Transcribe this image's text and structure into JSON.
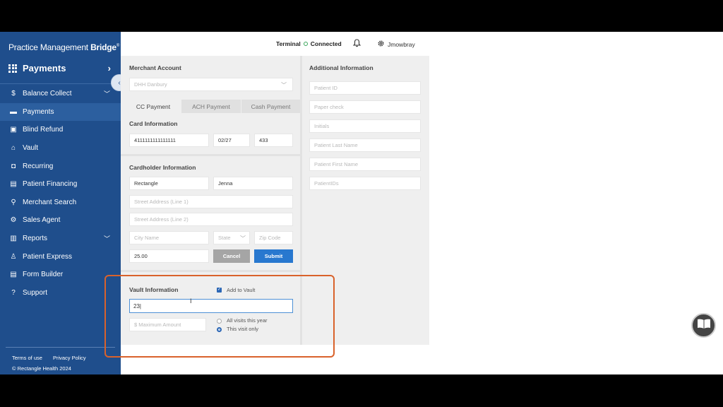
{
  "brand": {
    "name_prefix": "Practice Management ",
    "name_bold": "Bridge",
    "mark": "®"
  },
  "section": {
    "title": "Payments",
    "chevron": "›"
  },
  "nav": [
    {
      "label": "Balance Collect",
      "icon": "$",
      "has_chevron": true
    },
    {
      "label": "Payments",
      "icon": "▬",
      "active": true
    },
    {
      "label": "Blind Refund",
      "icon": "▣"
    },
    {
      "label": "Vault",
      "icon": "⌂"
    },
    {
      "label": "Recurring",
      "icon": "◘"
    },
    {
      "label": "Patient Financing",
      "icon": "▤"
    },
    {
      "label": "Merchant Search",
      "icon": "⚲"
    },
    {
      "label": "Sales Agent",
      "icon": "⚙"
    },
    {
      "label": "Reports",
      "icon": "▥",
      "has_chevron": true
    },
    {
      "label": "Patient Express",
      "icon": "♙"
    },
    {
      "label": "Form Builder",
      "icon": "▤"
    },
    {
      "label": "Support",
      "icon": "?"
    }
  ],
  "footer": {
    "terms": "Terms of use",
    "privacy": "Privacy Policy",
    "copyright": "© Rectangle Health 2024"
  },
  "topbar": {
    "terminal_label": "Terminal",
    "terminal_status": "Connected",
    "username": "Jmowbray"
  },
  "merchant": {
    "header": "Merchant Account",
    "selected": "DHH Danbury"
  },
  "tabs": {
    "cc": "CC Payment",
    "ach": "ACH Payment",
    "cash": "Cash Payment"
  },
  "card": {
    "header": "Card Information",
    "number": "4111111111111111",
    "expiry": "02/27",
    "cvv": "433"
  },
  "cardholder": {
    "header": "Cardholder Information",
    "last_name": "Rectangle",
    "first_name": "Jenna",
    "street1_placeholder": "Street Address (Line 1)",
    "street2_placeholder": "Street Address (Line 2)",
    "city_placeholder": "City Name",
    "state_placeholder": "State",
    "zip_placeholder": "Zip Code",
    "amount": "25.00",
    "cancel": "Cancel",
    "submit": "Submit"
  },
  "vault": {
    "header": "Vault Information",
    "add_label": "Add to Vault",
    "add_checked": true,
    "value": "23",
    "max_placeholder": "$ Maximum Amount",
    "opt_all": "All visits this year",
    "opt_this": "This visit only",
    "selected_option": "This visit only"
  },
  "additional": {
    "header": "Additional Information",
    "fields": [
      "Patient ID",
      "Paper check",
      "Initials",
      "Patient Last Name",
      "Patient First Name",
      "PatientIDs"
    ]
  },
  "colors": {
    "sidebar": "#1f4e8c",
    "accent": "#2878cf",
    "highlight": "#d9622b",
    "status_ok": "#3aa65b"
  }
}
